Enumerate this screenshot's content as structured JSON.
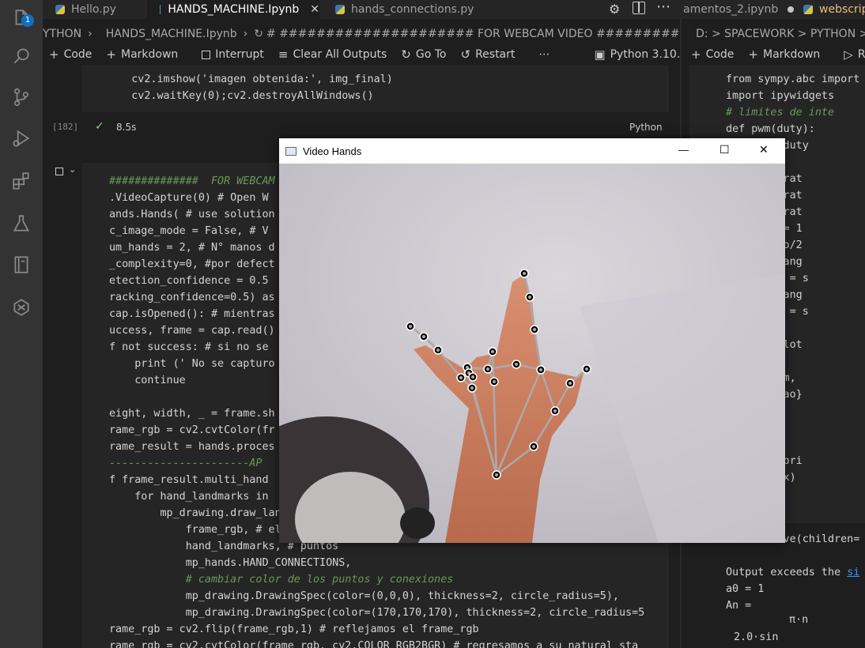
{
  "activity_bar": {
    "explorer_badge": "1"
  },
  "tabs": [
    {
      "label": "Hello.py",
      "active": false
    },
    {
      "label": "HANDS_MACHINE.Ipynb",
      "active": true
    },
    {
      "label": "hands_connections.py",
      "active": false
    }
  ],
  "right_tabs": [
    {
      "label": "amentos_2.ipynb"
    },
    {
      "label": "webscrip"
    }
  ],
  "left_breadcrumb": {
    "folder": "YTHON",
    "file": "HANDS_MACHINE.Ipynb",
    "cell": "# ##################### FOR WEBCAM VIDEO ###################"
  },
  "right_breadcrumb": {
    "path": "D: > SPACEWORK > PYTHON > Ar"
  },
  "toolbar": {
    "code": "Code",
    "markdown": "Markdown",
    "interrupt": "Interrupt",
    "clear_outputs": "Clear All Outputs",
    "go_to": "Go To",
    "restart": "Restart",
    "kernel": "Python 3.10.10"
  },
  "right_toolbar": {
    "code": "Code",
    "markdown": "Markdown",
    "run": "R"
  },
  "cell_prev": {
    "exec_count": "[182]",
    "duration": "8.5s",
    "language": "Python",
    "lines": [
      "    cv2.imshow('imagen obtenida:', img_final)",
      "    cv2.waitKey(0);cv2.destroyAllWindows()"
    ]
  },
  "cell_code_lines": [
    "##############  FOR WEBCAM",
    ".VideoCapture(0) # Open W",
    "ands.Hands( # use solution",
    "c_image_mode = False, # V",
    "um_hands = 2, # N° manos d",
    "_complexity=0, #por defect",
    "etection_confidence = 0.5",
    "racking_confidence=0.5) as",
    "cap.isOpened(): # mientras",
    "uccess, frame = cap.read()",
    "f not success: # si no se",
    "    print (' No se capturo",
    "    continue",
    "",
    "eight, width, _ = frame.sh",
    "rame_rgb = cv2.cvtColor(fr",
    "rame_result = hands.proces",
    "----------------------AP",
    "f frame_result.multi_hand",
    "    for hand_landmarks in",
    "        mp_drawing.draw_lan",
    "            frame_rgb, # el",
    "            hand_landmarks, # puntos",
    "            mp_hands.HAND_CONNECTIONS,",
    "            # cambiar color de los puntos y conexiones",
    "            mp_drawing.DrawingSpec(color=(0,0,0), thickness=2, circle_radius=5),",
    "            mp_drawing.DrawingSpec(color=(170,170,170), thickness=2, circle_radius=5",
    "rame_rgb = cv2.flip(frame_rgb,1) # reflejamos el frame_rgb",
    "rame_rgb = cv2.cvtColor(frame_rgb, cv2.COLOR_RGB2BGR) # regresamos a su natural sta"
  ],
  "right_code_lines": [
    "from sympy.abc import",
    "import ipywidgets",
    "# limites de inte",
    "def pwm(duty):",
    "duty = 2*duty",
    "",
    "o = integrat",
    "n = integrat",
    "n = integrat",
    "rmonicos = 1",
    "erie = (ao/2",
    "or i in rang",
    "    serie = s",
    "or j in rang",
    "    serie = s",
    "",
    "lotting.plot",
    "",
    "teract(pwm,",
    "(f'a0 = {ao}",
    "(\"An = \")",
    "t(an)",
    "(\"Bn = \")",
    "t(bn) # ppri",
    " (\"n + f(x)",
    "t(serie)"
  ],
  "right_output": {
    "line1": "interactive(children=",
    "line2_prefix": "Output exceeds the ",
    "line2_link": "si",
    "line3": "a0 = 1",
    "line4": "An =",
    "line5": "π·n",
    "line6": "2.0·sin"
  },
  "video_window": {
    "title": "Video Hands",
    "minimize": "—",
    "maximize": "☐",
    "close": "✕"
  },
  "colors": {
    "editor_bg": "#1e1e1e",
    "activity_bar": "#333333",
    "accent": "#0e70c0",
    "landmark": "#000000",
    "connection": "#aaaaaa"
  }
}
